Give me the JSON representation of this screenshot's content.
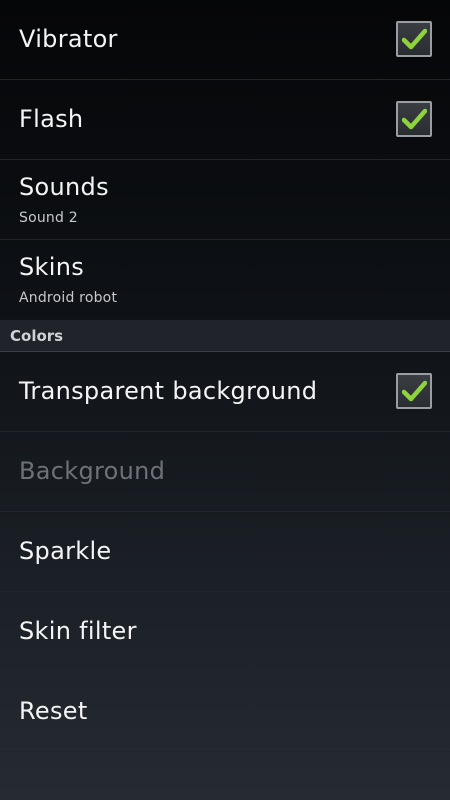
{
  "preferences": {
    "vibrator": {
      "title": "Vibrator",
      "checked": true
    },
    "flash": {
      "title": "Flash",
      "checked": true
    },
    "sounds": {
      "title": "Sounds",
      "summary": "Sound 2"
    },
    "skins": {
      "title": "Skins",
      "summary": "Android robot"
    }
  },
  "colors_section": {
    "header": "Colors",
    "transparent_background": {
      "title": "Transparent background",
      "checked": true
    },
    "background": {
      "title": "Background",
      "enabled": false
    },
    "sparkle": {
      "title": "Sparkle"
    },
    "skin_filter": {
      "title": "Skin filter"
    },
    "reset": {
      "title": "Reset"
    }
  },
  "theme": {
    "check_color": "#8fd33a",
    "disabled_text_color": "#6d7278"
  }
}
